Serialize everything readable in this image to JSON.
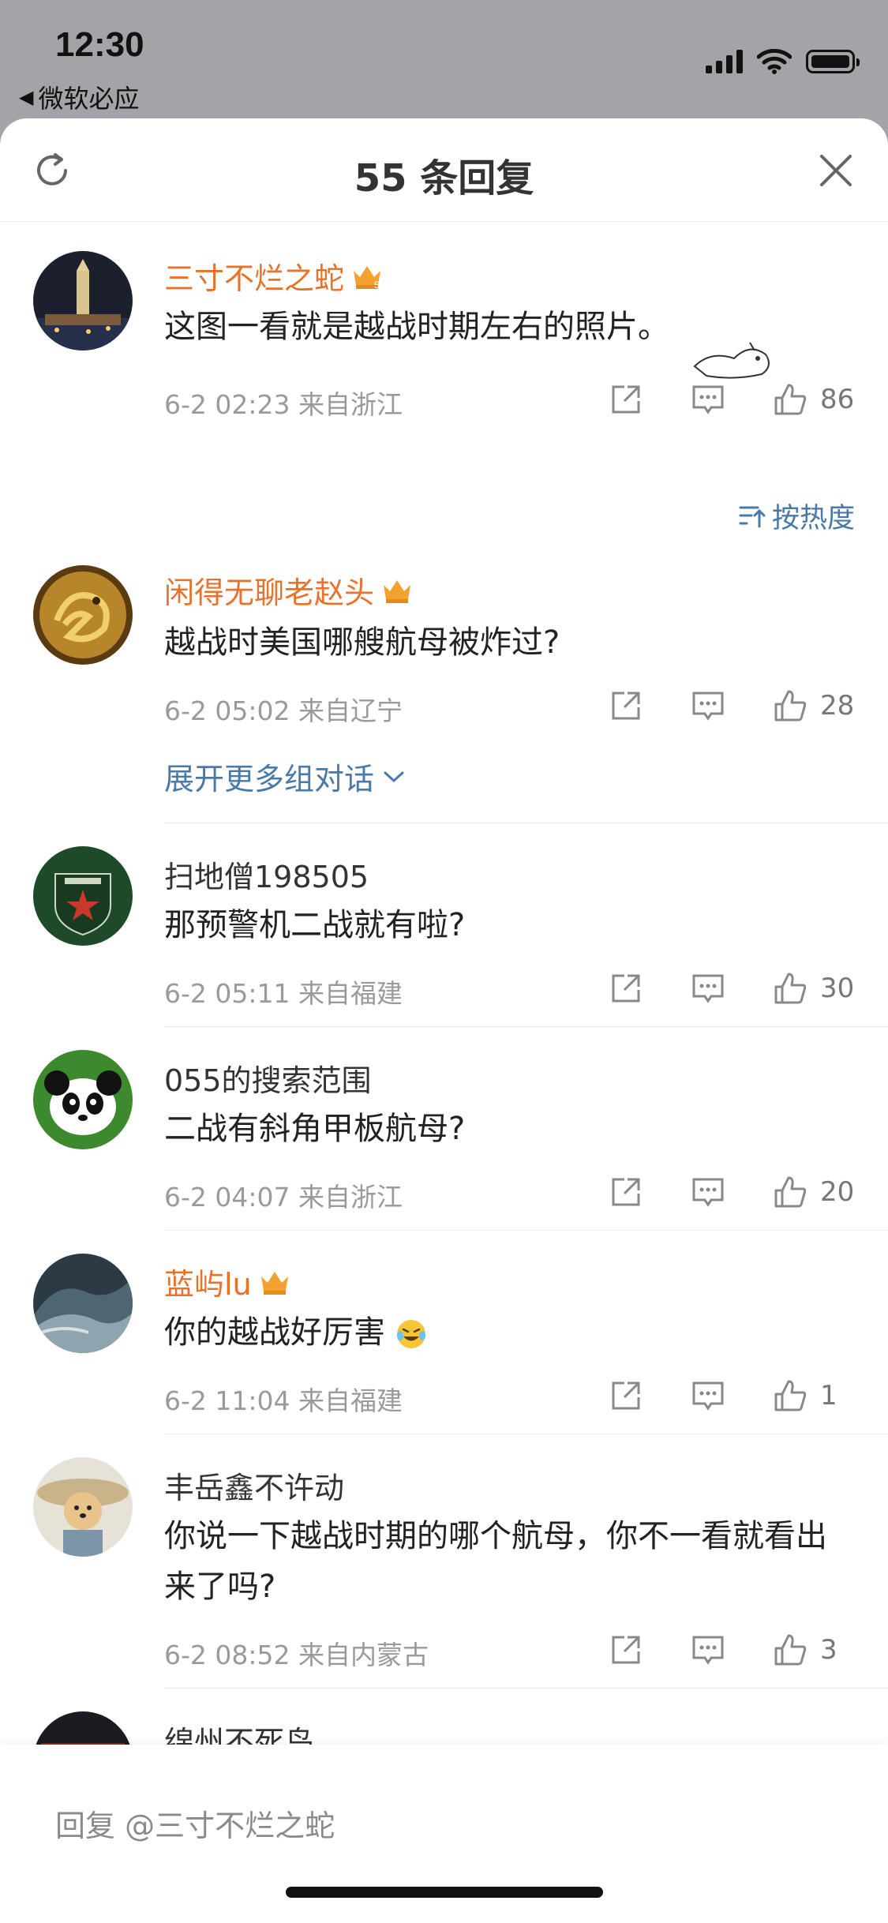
{
  "status_bar": {
    "time": "12:30",
    "back_app": "微软必应",
    "back_icon": "back-triangle-icon"
  },
  "header": {
    "title": "55 条回复",
    "refresh_icon": "refresh-icon",
    "close_icon": "close-icon"
  },
  "sort": {
    "label": "按热度",
    "icon": "sort-icon"
  },
  "expand": {
    "label": "展开更多组对话"
  },
  "comments": [
    {
      "name": "三寸不烂之蛇",
      "vip": true,
      "crown_level": "5",
      "text": "这图一看就是越战时期左右的照片。",
      "time": "6-2 02:23",
      "location": "来自浙江",
      "likes": "86",
      "name_color": "#e8722b"
    },
    {
      "name": "闲得无聊老赵头",
      "vip": true,
      "text": "越战时美国哪艘航母被炸过?",
      "time": "6-2 05:02",
      "location": "来自辽宁",
      "likes": "28",
      "name_color": "#e8722b"
    },
    {
      "name": "扫地僧198505",
      "vip": false,
      "text": "那预警机二战就有啦?",
      "time": "6-2 05:11",
      "location": "来自福建",
      "likes": "30"
    },
    {
      "name": "055的搜索范围",
      "vip": false,
      "text": "二战有斜角甲板航母?",
      "time": "6-2 04:07",
      "location": "来自浙江",
      "likes": "20"
    },
    {
      "name": "蓝屿lu",
      "vip": true,
      "text": "你的越战好厉害",
      "emoji": "laugh-cry-emoji",
      "time": "6-2 11:04",
      "location": "来自福建",
      "likes": "1",
      "name_color": "#e8722b"
    },
    {
      "name": "丰岳鑫不许动",
      "vip": false,
      "text": "你说一下越战时期的哪个航母，你不一看就看出来了吗?",
      "time": "6-2 08:52",
      "location": "来自内蒙古",
      "likes": "3"
    },
    {
      "name": "绵州不死鸟",
      "vip": false
    }
  ],
  "reply": {
    "placeholder": "回复 @三寸不烂之蛇"
  },
  "colors": {
    "vip_name": "#e8722b",
    "link": "#4a79a8",
    "meta": "#9a9a9a"
  }
}
